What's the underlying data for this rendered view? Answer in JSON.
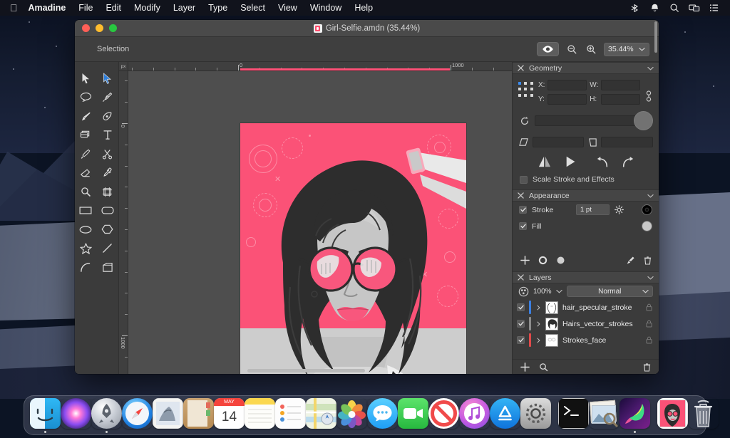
{
  "menubar": {
    "apple": "apple-logo",
    "items": [
      {
        "label": "Amadine",
        "bold": true
      },
      {
        "label": "File",
        "bold": false
      },
      {
        "label": "Edit",
        "bold": false
      },
      {
        "label": "Modify",
        "bold": false
      },
      {
        "label": "Layer",
        "bold": false
      },
      {
        "label": "Type",
        "bold": false
      },
      {
        "label": "Select",
        "bold": false
      },
      {
        "label": "View",
        "bold": false
      },
      {
        "label": "Window",
        "bold": false
      },
      {
        "label": "Help",
        "bold": false
      }
    ],
    "status_icons": [
      "bluetooth-icon",
      "notification-bell-icon",
      "spotlight-search-icon",
      "screen-mirroring-icon",
      "control-center-icon"
    ]
  },
  "window": {
    "title": "Girl-Selfie.amdn (35.44%)",
    "document_name": "Girl-Selfie.amdn",
    "zoom_in_title": "35.44%",
    "traffic_lights": [
      "close",
      "minimize",
      "zoom"
    ],
    "toolbar": {
      "mode_label": "Selection",
      "preview_icon": "eye-icon",
      "zoom_out_icon": "zoom-out-icon",
      "zoom_in_icon": "zoom-in-icon",
      "zoom_value": "35.44%",
      "zoom_chevron": "chevron-down-icon"
    }
  },
  "tools": [
    {
      "name": "selection-tool",
      "icon": "arrow-black-icon"
    },
    {
      "name": "direct-selection-tool",
      "icon": "arrow-blue-icon",
      "selected": true
    },
    {
      "name": "lasso-tool",
      "icon": "lasso-icon"
    },
    {
      "name": "pen-tool",
      "icon": "pen-icon"
    },
    {
      "name": "brush-tool",
      "icon": "brush-icon"
    },
    {
      "name": "pencil-tool",
      "icon": "pencil-node-icon"
    },
    {
      "name": "shape-builder-tool",
      "icon": "shape-builder-icon"
    },
    {
      "name": "type-tool",
      "icon": "type-t-icon"
    },
    {
      "name": "knife-tool",
      "icon": "knife-icon"
    },
    {
      "name": "scissors-tool",
      "icon": "scissors-icon"
    },
    {
      "name": "eraser-tool",
      "icon": "eraser-icon"
    },
    {
      "name": "eyedropper-tool",
      "icon": "eyedropper-icon"
    },
    {
      "name": "zoom-tool",
      "icon": "magnifier-icon"
    },
    {
      "name": "artboard-tool",
      "icon": "artboard-icon"
    },
    {
      "name": "rectangle-tool",
      "icon": "rectangle-icon"
    },
    {
      "name": "rounded-rectangle-tool",
      "icon": "rounded-rectangle-icon"
    },
    {
      "name": "ellipse-tool",
      "icon": "ellipse-icon"
    },
    {
      "name": "polygon-tool",
      "icon": "polygon-icon"
    },
    {
      "name": "star-tool",
      "icon": "star-icon"
    },
    {
      "name": "line-tool",
      "icon": "line-icon"
    },
    {
      "name": "arc-tool",
      "icon": "arc-icon"
    },
    {
      "name": "spiral-tool",
      "icon": "corner-shape-icon"
    }
  ],
  "rulers": {
    "unit": "px",
    "horizontal_labels": [
      "0",
      "1000"
    ],
    "vertical_labels": [
      "0",
      "1000"
    ]
  },
  "inspector": {
    "geometry": {
      "title": "Geometry",
      "close_icon": "close-x-icon",
      "collapse_icon": "chevron-down-icon",
      "anchor_icon": "anchor-point-grid",
      "fields": [
        {
          "label": "X:",
          "value": ""
        },
        {
          "label": "W:",
          "value": ""
        },
        {
          "label": "Y:",
          "value": ""
        },
        {
          "label": "H:",
          "value": ""
        }
      ],
      "link_icon": "link-chain-icon",
      "rotate_icon": "rotate-icon",
      "rotate_value": "",
      "shear_h_icon": "shear-horizontal-icon",
      "shear_h_value": "",
      "shear_v_icon": "shear-vertical-icon",
      "shear_v_value": "",
      "transform_buttons": [
        "flip-horizontal-icon",
        "flip-vertical-icon",
        "rotate-left-icon",
        "rotate-right-icon"
      ],
      "scale_checkbox_label": "Scale Stroke and Effects",
      "scale_checkbox_checked": false
    },
    "appearance": {
      "title": "Appearance",
      "close_icon": "close-x-icon",
      "collapse_icon": "chevron-down-icon",
      "rows": [
        {
          "label": "Stroke",
          "checked": true,
          "value": "1 pt",
          "has_gear": true,
          "swatch": "#000000"
        },
        {
          "label": "Fill",
          "checked": true,
          "value": "",
          "has_gear": false,
          "swatch": "#c8c8c8"
        }
      ],
      "footer_icons": [
        "add-plus-icon",
        "add-stroke-icon",
        "add-fill-icon",
        "clear-appearance-icon",
        "delete-trash-icon"
      ]
    },
    "layers": {
      "title": "Layers",
      "close_icon": "close-x-icon",
      "collapse_icon": "chevron-down-icon",
      "opacity_icon": "opacity-icon",
      "opacity_value": "100%",
      "opacity_chevron": "chevron-down-icon",
      "blend_mode": "Normal",
      "blend_chevron": "chevron-down-icon",
      "rows": [
        {
          "name": "hair_specular_stroke",
          "visible": true,
          "color": "#3b7fe0",
          "locked": false
        },
        {
          "name": "Hairs_vector_strokes",
          "visible": true,
          "color": "#8c8c8c",
          "locked": false
        },
        {
          "name": "Strokes_face",
          "visible": true,
          "color": "#e04a4a",
          "locked": false
        }
      ],
      "footer_icons": [
        "add-layer-icon",
        "search-layer-icon",
        "delete-layer-icon"
      ]
    }
  },
  "artwork": {
    "description": "Vector illustration of a woman with curly dark hair wearing round pink sunglasses",
    "background_color": "#fb5277",
    "floor_color": "#cdcdcd",
    "hair_color": "#2b2b2b",
    "skin_color": "#c4c4c4"
  },
  "dock": {
    "items": [
      {
        "name": "finder",
        "running": true
      },
      {
        "name": "siri",
        "running": false
      },
      {
        "name": "launchpad",
        "running": true
      },
      {
        "name": "safari",
        "running": false
      },
      {
        "name": "mail",
        "running": false
      },
      {
        "name": "contacts",
        "running": false
      },
      {
        "name": "calendar",
        "running": false,
        "month": "MAY",
        "day": "14"
      },
      {
        "name": "notes",
        "running": false
      },
      {
        "name": "reminders",
        "running": false
      },
      {
        "name": "maps",
        "running": false
      },
      {
        "name": "photos",
        "running": false
      },
      {
        "name": "messages",
        "running": false
      },
      {
        "name": "facetime",
        "running": false
      },
      {
        "name": "restricted",
        "running": false
      },
      {
        "name": "itunes",
        "running": false
      },
      {
        "name": "app-store",
        "running": false
      },
      {
        "name": "system-preferences",
        "running": false
      },
      {
        "name": "separator-1",
        "separator": true
      },
      {
        "name": "terminal",
        "running": false
      },
      {
        "name": "preview",
        "running": false
      },
      {
        "name": "amadine",
        "running": true
      },
      {
        "name": "separator-2",
        "separator": true
      },
      {
        "name": "girl-selfie-file",
        "running": false
      },
      {
        "name": "trash",
        "running": false
      }
    ]
  }
}
